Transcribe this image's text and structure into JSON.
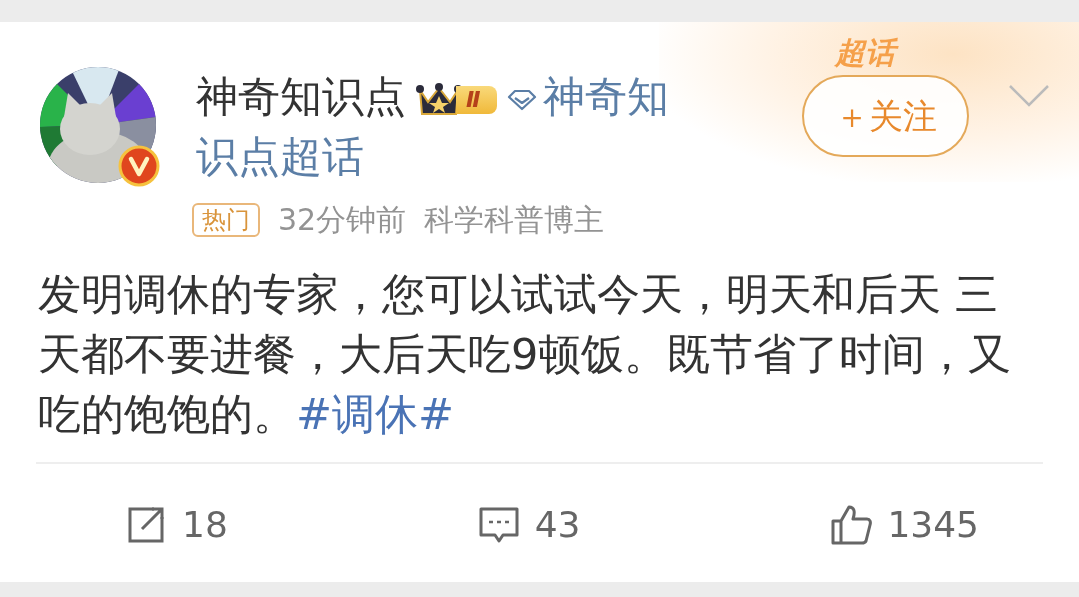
{
  "post": {
    "author": {
      "name": "神奇知识点",
      "verified": true,
      "level_badge": "Ⅱ",
      "supertopic_lines": [
        "神奇知",
        "识点超话"
      ]
    },
    "decoration": "超话",
    "follow_button": "＋关注",
    "meta": {
      "tag": "热门",
      "time": "32分钟前",
      "category": "科学科普博主"
    },
    "body": "发明调休的专家，您可以试试今天，明天和后天 三天都不要进餐，大后天吃9顿饭。既节省了时间，又吃的饱饱的。",
    "hashtag": "#调休#",
    "actions": [
      {
        "kind": "repost",
        "count": "18"
      },
      {
        "kind": "comment",
        "count": "43"
      },
      {
        "kind": "like",
        "count": "1345"
      }
    ]
  }
}
